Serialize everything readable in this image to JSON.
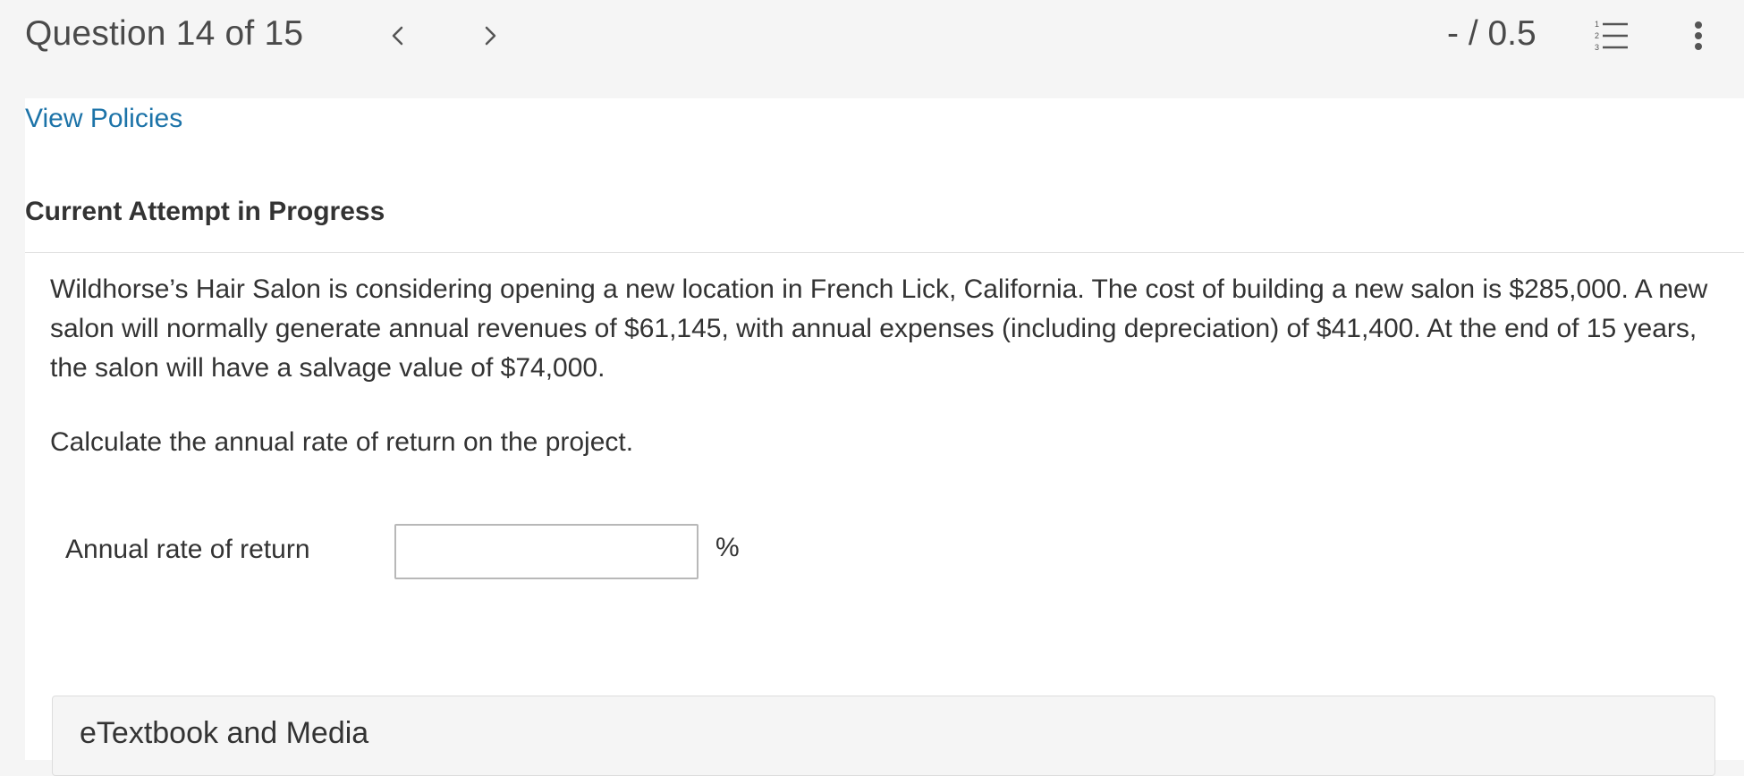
{
  "header": {
    "question_counter": "Question 14 of 15",
    "score": "- / 0.5"
  },
  "icons": {
    "prev": "chevron-left-icon",
    "next": "chevron-right-icon",
    "question_list": "numbered-list-icon",
    "more": "vertical-ellipsis-icon"
  },
  "policies_link": "View Policies",
  "attempt_heading": "Current Attempt in Progress",
  "question": {
    "text": "Wildhorse’s Hair Salon is considering opening a new location in French Lick, California. The cost of building a new salon is $285,000. A new salon will normally generate annual revenues of $61,145, with annual expenses (including depreciation) of $41,400. At the end of 15 years, the salon will have a salvage value of $74,000.",
    "instruction": "Calculate the annual rate of return on the project."
  },
  "answer": {
    "label": "Annual rate of return",
    "value": "",
    "unit": "%"
  },
  "resources": {
    "label": "eTextbook and Media"
  },
  "colors": {
    "link": "#1c73a8",
    "background": "#f5f5f5",
    "panel": "#ffffff",
    "text": "#333333"
  }
}
